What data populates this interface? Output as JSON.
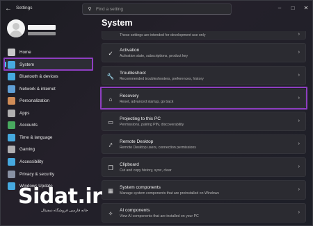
{
  "window": {
    "title": "Settings",
    "back_icon": "back-arrow-icon",
    "controls": [
      "minimize-icon",
      "maximize-icon",
      "close-icon"
    ]
  },
  "search": {
    "placeholder": "Find a setting",
    "icon": "search-icon"
  },
  "sidebar": {
    "items": [
      {
        "label": "Home",
        "icon": "home-icon",
        "color": "#e8e8e8",
        "active": false
      },
      {
        "label": "System",
        "icon": "system-icon",
        "color": "#4cc2ff",
        "active": true
      },
      {
        "label": "Bluetooth & devices",
        "icon": "bluetooth-icon",
        "color": "#4cc2ff",
        "active": false
      },
      {
        "label": "Network & internet",
        "icon": "network-icon",
        "color": "#6cb6f5",
        "active": false
      },
      {
        "label": "Personalization",
        "icon": "brush-icon",
        "color": "#f0a060",
        "active": false
      },
      {
        "label": "Apps",
        "icon": "apps-icon",
        "color": "#c9c9c9",
        "active": false
      },
      {
        "label": "Accounts",
        "icon": "accounts-icon",
        "color": "#4fc26a",
        "active": false
      },
      {
        "label": "Time & language",
        "icon": "clock-icon",
        "color": "#4cc2ff",
        "active": false
      },
      {
        "label": "Gaming",
        "icon": "gamepad-icon",
        "color": "#c9c9c9",
        "active": false
      },
      {
        "label": "Accessibility",
        "icon": "accessibility-icon",
        "color": "#4cc2ff",
        "active": false
      },
      {
        "label": "Privacy & security",
        "icon": "shield-icon",
        "color": "#9aa6b8",
        "active": false
      },
      {
        "label": "Windows Update",
        "icon": "update-icon",
        "color": "#4cc2ff",
        "active": false
      }
    ]
  },
  "main": {
    "title": "System",
    "top_strip_text": "These settings are intended for development use only",
    "cards": [
      {
        "title": "Activation",
        "subtitle": "Activation state, subscriptions, product key",
        "icon": "activation-icon",
        "glyph": "✓"
      },
      {
        "title": "Troubleshoot",
        "subtitle": "Recommended troubleshooters, preferences, history",
        "icon": "wrench-icon",
        "glyph": "🔧"
      },
      {
        "title": "Recovery",
        "subtitle": "Reset, advanced startup, go back",
        "icon": "recovery-icon",
        "glyph": "⌂"
      },
      {
        "title": "Projecting to this PC",
        "subtitle": "Permissions, pairing PIN, discoverability",
        "icon": "projecting-icon",
        "glyph": "▭"
      },
      {
        "title": "Remote Desktop",
        "subtitle": "Remote Desktop users, connection permissions",
        "icon": "remote-desktop-icon",
        "glyph": "⤤"
      },
      {
        "title": "Clipboard",
        "subtitle": "Cut and copy history, sync, clear",
        "icon": "clipboard-icon",
        "glyph": "❐"
      },
      {
        "title": "System components",
        "subtitle": "Manage system components that are preinstalled on Windows",
        "icon": "components-icon",
        "glyph": "▦"
      },
      {
        "title": "AI components",
        "subtitle": "View AI components that are installed on your PC",
        "icon": "ai-components-icon",
        "glyph": "✧"
      }
    ],
    "chevron": "›"
  },
  "watermark": {
    "brand": "Sidat.ir",
    "tagline": "خانه فارسی فروشگاه دیجیتال"
  },
  "accent": "#4cc2ff",
  "highlight_color": "#8e3ec1"
}
